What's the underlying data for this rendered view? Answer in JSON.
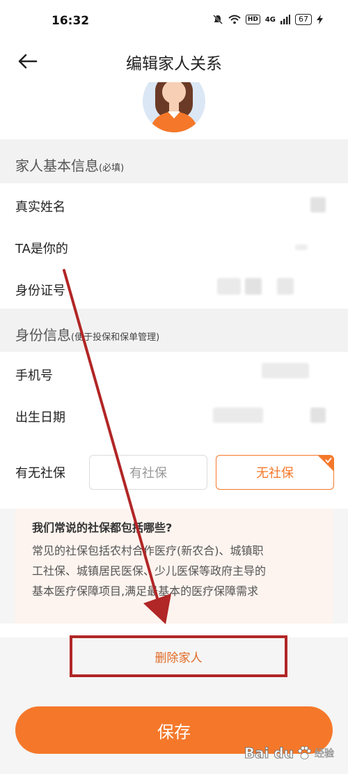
{
  "status_bar": {
    "time": "16:32",
    "network": "4G",
    "battery": "67"
  },
  "nav": {
    "title": "编辑家人关系"
  },
  "basic_section": {
    "title": "家人基本信息",
    "note": "(必填)",
    "fields": [
      {
        "label": "真实姓名"
      },
      {
        "label": "TA是你的"
      },
      {
        "label": "身份证号"
      }
    ]
  },
  "identity_section": {
    "title": "身份信息",
    "note": "(便于投保和保单管理)",
    "fields": [
      {
        "label": "手机号"
      },
      {
        "label": "出生日期"
      }
    ]
  },
  "social_security": {
    "label": "有无社保",
    "options": [
      "有社保",
      "无社保"
    ],
    "selected": "无社保"
  },
  "info_box": {
    "title": "我们常说的社保都包括哪些?",
    "lines": [
      "常见的社保包括农村合作医疗(新农合)、城镇职",
      "工社保、城镇居民医保、少儿医保等政府主导的",
      "基本医疗保障项目,满足最基本的医疗保障需求"
    ]
  },
  "actions": {
    "delete_label": "删除家人",
    "save_label": "保存"
  },
  "watermark": {
    "brand": "Bai du",
    "sub": "经验"
  },
  "colors": {
    "accent": "#f5782a",
    "annotation_red": "#b12626"
  },
  "icons": {
    "back": "arrow-left-icon",
    "silent": "bell-off-icon",
    "wifi": "wifi-icon",
    "signal": "signal-icon",
    "charging": "bolt-icon",
    "check": "check-icon"
  }
}
